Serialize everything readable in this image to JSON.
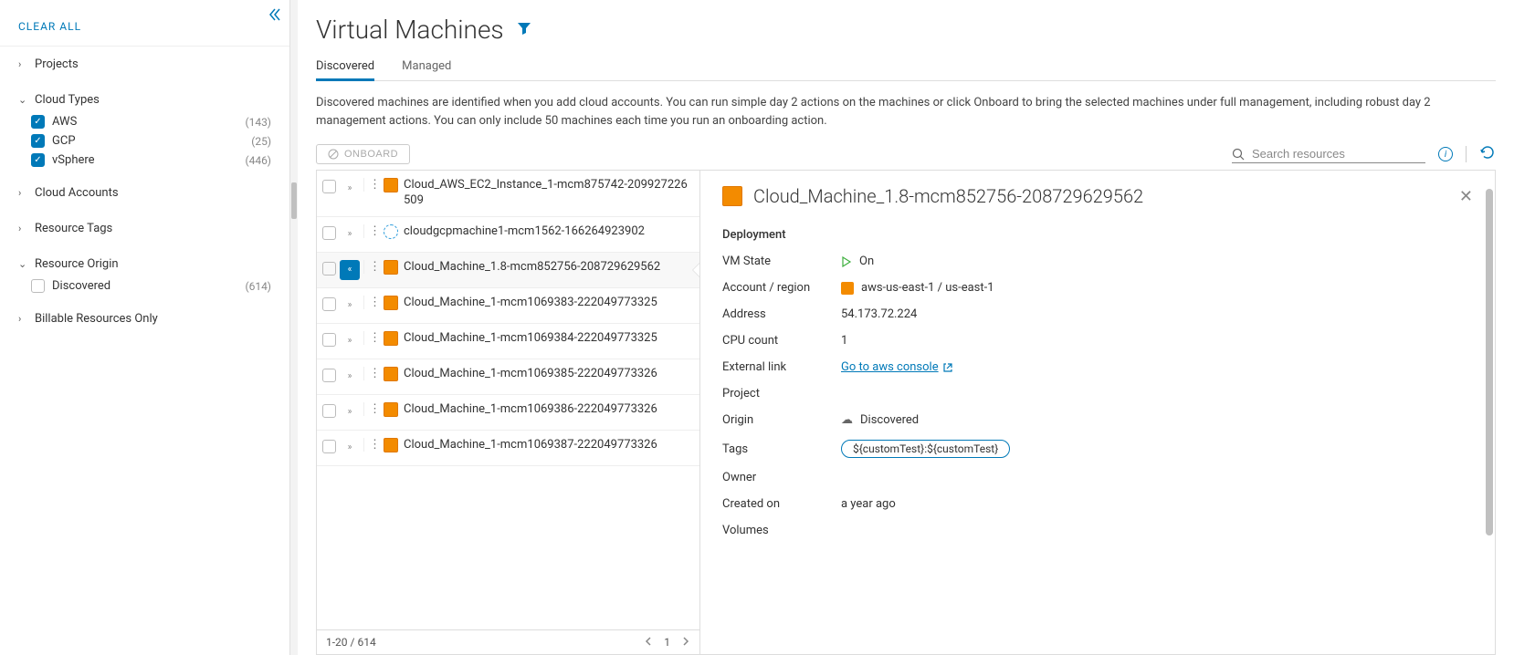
{
  "sidebar": {
    "clear_all": "CLEAR ALL",
    "groups": [
      {
        "title": "Projects",
        "expanded": false,
        "items": []
      },
      {
        "title": "Cloud Types",
        "expanded": true,
        "items": [
          {
            "label": "AWS",
            "checked": true,
            "count": "(143)"
          },
          {
            "label": "GCP",
            "checked": true,
            "count": "(25)"
          },
          {
            "label": "vSphere",
            "checked": true,
            "count": "(446)"
          }
        ]
      },
      {
        "title": "Cloud Accounts",
        "expanded": false,
        "items": []
      },
      {
        "title": "Resource Tags",
        "expanded": false,
        "items": []
      },
      {
        "title": "Resource Origin",
        "expanded": true,
        "items": [
          {
            "label": "Discovered",
            "checked": false,
            "count": "(614)"
          }
        ]
      },
      {
        "title": "Billable Resources Only",
        "expanded": false,
        "items": []
      }
    ]
  },
  "page": {
    "title": "Virtual Machines",
    "tabs": [
      "Discovered",
      "Managed"
    ],
    "active_tab": 0,
    "description": "Discovered machines are identified when you add cloud accounts. You can run simple day 2 actions on the machines or click Onboard to bring the selected machines under full management, including robust day 2 management actions. You can only include 50 machines each time you run an onboarding action.",
    "onboard_label": "ONBOARD",
    "search_placeholder": "Search resources"
  },
  "table": {
    "rows": [
      {
        "name": "Cloud_AWS_EC2_Instance_1-mcm875742-209927226509",
        "type": "aws",
        "selected": false
      },
      {
        "name": "cloudgcpmachine1-mcm1562-166264923902",
        "type": "gcp",
        "selected": false
      },
      {
        "name": "Cloud_Machine_1.8-mcm852756-208729629562",
        "type": "aws",
        "selected": true
      },
      {
        "name": "Cloud_Machine_1-mcm1069383-222049773325",
        "type": "aws",
        "selected": false
      },
      {
        "name": "Cloud_Machine_1-mcm1069384-222049773325",
        "type": "aws",
        "selected": false
      },
      {
        "name": "Cloud_Machine_1-mcm1069385-222049773326",
        "type": "aws",
        "selected": false
      },
      {
        "name": "Cloud_Machine_1-mcm1069386-222049773326",
        "type": "aws",
        "selected": false
      },
      {
        "name": "Cloud_Machine_1-mcm1069387-222049773326",
        "type": "aws",
        "selected": false
      }
    ],
    "pager_text": "1-20 / 614",
    "pager_page": "1"
  },
  "detail": {
    "title": "Cloud_Machine_1.8-mcm852756-208729629562",
    "deployment_label": "Deployment",
    "fields": {
      "vm_state_label": "VM State",
      "vm_state_value": "On",
      "account_label": "Account / region",
      "account_value": "aws-us-east-1 / us-east-1",
      "address_label": "Address",
      "address_value": "54.173.72.224",
      "cpu_label": "CPU count",
      "cpu_value": "1",
      "external_link_label": "External link",
      "external_link_value": "Go to aws console",
      "project_label": "Project",
      "origin_label": "Origin",
      "origin_value": "Discovered",
      "tags_label": "Tags",
      "tags_value": "${customTest}:${customTest}",
      "owner_label": "Owner",
      "created_label": "Created on",
      "created_value": "a year ago",
      "volumes_label": "Volumes"
    }
  }
}
